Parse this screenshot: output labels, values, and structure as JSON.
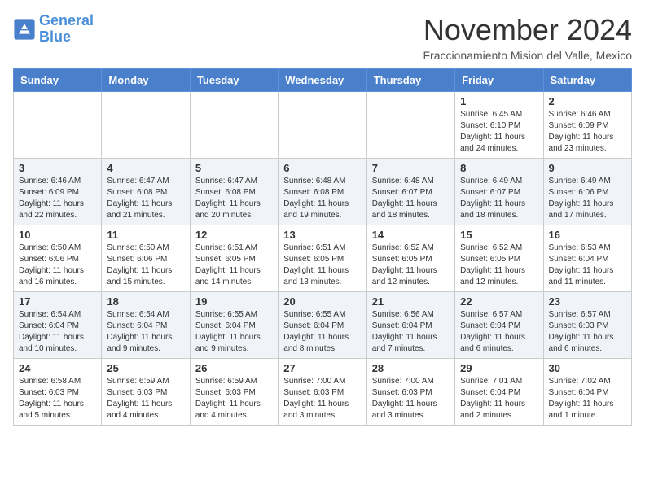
{
  "logo": {
    "line1": "General",
    "line2": "Blue"
  },
  "title": "November 2024",
  "subtitle": "Fraccionamiento Mision del Valle, Mexico",
  "weekdays": [
    "Sunday",
    "Monday",
    "Tuesday",
    "Wednesday",
    "Thursday",
    "Friday",
    "Saturday"
  ],
  "weeks": [
    [
      {
        "day": "",
        "sunrise": "",
        "sunset": "",
        "daylight": ""
      },
      {
        "day": "",
        "sunrise": "",
        "sunset": "",
        "daylight": ""
      },
      {
        "day": "",
        "sunrise": "",
        "sunset": "",
        "daylight": ""
      },
      {
        "day": "",
        "sunrise": "",
        "sunset": "",
        "daylight": ""
      },
      {
        "day": "",
        "sunrise": "",
        "sunset": "",
        "daylight": ""
      },
      {
        "day": "1",
        "sunrise": "Sunrise: 6:45 AM",
        "sunset": "Sunset: 6:10 PM",
        "daylight": "Daylight: 11 hours and 24 minutes."
      },
      {
        "day": "2",
        "sunrise": "Sunrise: 6:46 AM",
        "sunset": "Sunset: 6:09 PM",
        "daylight": "Daylight: 11 hours and 23 minutes."
      }
    ],
    [
      {
        "day": "3",
        "sunrise": "Sunrise: 6:46 AM",
        "sunset": "Sunset: 6:09 PM",
        "daylight": "Daylight: 11 hours and 22 minutes."
      },
      {
        "day": "4",
        "sunrise": "Sunrise: 6:47 AM",
        "sunset": "Sunset: 6:08 PM",
        "daylight": "Daylight: 11 hours and 21 minutes."
      },
      {
        "day": "5",
        "sunrise": "Sunrise: 6:47 AM",
        "sunset": "Sunset: 6:08 PM",
        "daylight": "Daylight: 11 hours and 20 minutes."
      },
      {
        "day": "6",
        "sunrise": "Sunrise: 6:48 AM",
        "sunset": "Sunset: 6:08 PM",
        "daylight": "Daylight: 11 hours and 19 minutes."
      },
      {
        "day": "7",
        "sunrise": "Sunrise: 6:48 AM",
        "sunset": "Sunset: 6:07 PM",
        "daylight": "Daylight: 11 hours and 18 minutes."
      },
      {
        "day": "8",
        "sunrise": "Sunrise: 6:49 AM",
        "sunset": "Sunset: 6:07 PM",
        "daylight": "Daylight: 11 hours and 18 minutes."
      },
      {
        "day": "9",
        "sunrise": "Sunrise: 6:49 AM",
        "sunset": "Sunset: 6:06 PM",
        "daylight": "Daylight: 11 hours and 17 minutes."
      }
    ],
    [
      {
        "day": "10",
        "sunrise": "Sunrise: 6:50 AM",
        "sunset": "Sunset: 6:06 PM",
        "daylight": "Daylight: 11 hours and 16 minutes."
      },
      {
        "day": "11",
        "sunrise": "Sunrise: 6:50 AM",
        "sunset": "Sunset: 6:06 PM",
        "daylight": "Daylight: 11 hours and 15 minutes."
      },
      {
        "day": "12",
        "sunrise": "Sunrise: 6:51 AM",
        "sunset": "Sunset: 6:05 PM",
        "daylight": "Daylight: 11 hours and 14 minutes."
      },
      {
        "day": "13",
        "sunrise": "Sunrise: 6:51 AM",
        "sunset": "Sunset: 6:05 PM",
        "daylight": "Daylight: 11 hours and 13 minutes."
      },
      {
        "day": "14",
        "sunrise": "Sunrise: 6:52 AM",
        "sunset": "Sunset: 6:05 PM",
        "daylight": "Daylight: 11 hours and 12 minutes."
      },
      {
        "day": "15",
        "sunrise": "Sunrise: 6:52 AM",
        "sunset": "Sunset: 6:05 PM",
        "daylight": "Daylight: 11 hours and 12 minutes."
      },
      {
        "day": "16",
        "sunrise": "Sunrise: 6:53 AM",
        "sunset": "Sunset: 6:04 PM",
        "daylight": "Daylight: 11 hours and 11 minutes."
      }
    ],
    [
      {
        "day": "17",
        "sunrise": "Sunrise: 6:54 AM",
        "sunset": "Sunset: 6:04 PM",
        "daylight": "Daylight: 11 hours and 10 minutes."
      },
      {
        "day": "18",
        "sunrise": "Sunrise: 6:54 AM",
        "sunset": "Sunset: 6:04 PM",
        "daylight": "Daylight: 11 hours and 9 minutes."
      },
      {
        "day": "19",
        "sunrise": "Sunrise: 6:55 AM",
        "sunset": "Sunset: 6:04 PM",
        "daylight": "Daylight: 11 hours and 9 minutes."
      },
      {
        "day": "20",
        "sunrise": "Sunrise: 6:55 AM",
        "sunset": "Sunset: 6:04 PM",
        "daylight": "Daylight: 11 hours and 8 minutes."
      },
      {
        "day": "21",
        "sunrise": "Sunrise: 6:56 AM",
        "sunset": "Sunset: 6:04 PM",
        "daylight": "Daylight: 11 hours and 7 minutes."
      },
      {
        "day": "22",
        "sunrise": "Sunrise: 6:57 AM",
        "sunset": "Sunset: 6:04 PM",
        "daylight": "Daylight: 11 hours and 6 minutes."
      },
      {
        "day": "23",
        "sunrise": "Sunrise: 6:57 AM",
        "sunset": "Sunset: 6:03 PM",
        "daylight": "Daylight: 11 hours and 6 minutes."
      }
    ],
    [
      {
        "day": "24",
        "sunrise": "Sunrise: 6:58 AM",
        "sunset": "Sunset: 6:03 PM",
        "daylight": "Daylight: 11 hours and 5 minutes."
      },
      {
        "day": "25",
        "sunrise": "Sunrise: 6:59 AM",
        "sunset": "Sunset: 6:03 PM",
        "daylight": "Daylight: 11 hours and 4 minutes."
      },
      {
        "day": "26",
        "sunrise": "Sunrise: 6:59 AM",
        "sunset": "Sunset: 6:03 PM",
        "daylight": "Daylight: 11 hours and 4 minutes."
      },
      {
        "day": "27",
        "sunrise": "Sunrise: 7:00 AM",
        "sunset": "Sunset: 6:03 PM",
        "daylight": "Daylight: 11 hours and 3 minutes."
      },
      {
        "day": "28",
        "sunrise": "Sunrise: 7:00 AM",
        "sunset": "Sunset: 6:03 PM",
        "daylight": "Daylight: 11 hours and 3 minutes."
      },
      {
        "day": "29",
        "sunrise": "Sunrise: 7:01 AM",
        "sunset": "Sunset: 6:04 PM",
        "daylight": "Daylight: 11 hours and 2 minutes."
      },
      {
        "day": "30",
        "sunrise": "Sunrise: 7:02 AM",
        "sunset": "Sunset: 6:04 PM",
        "daylight": "Daylight: 11 hours and 1 minute."
      }
    ]
  ]
}
